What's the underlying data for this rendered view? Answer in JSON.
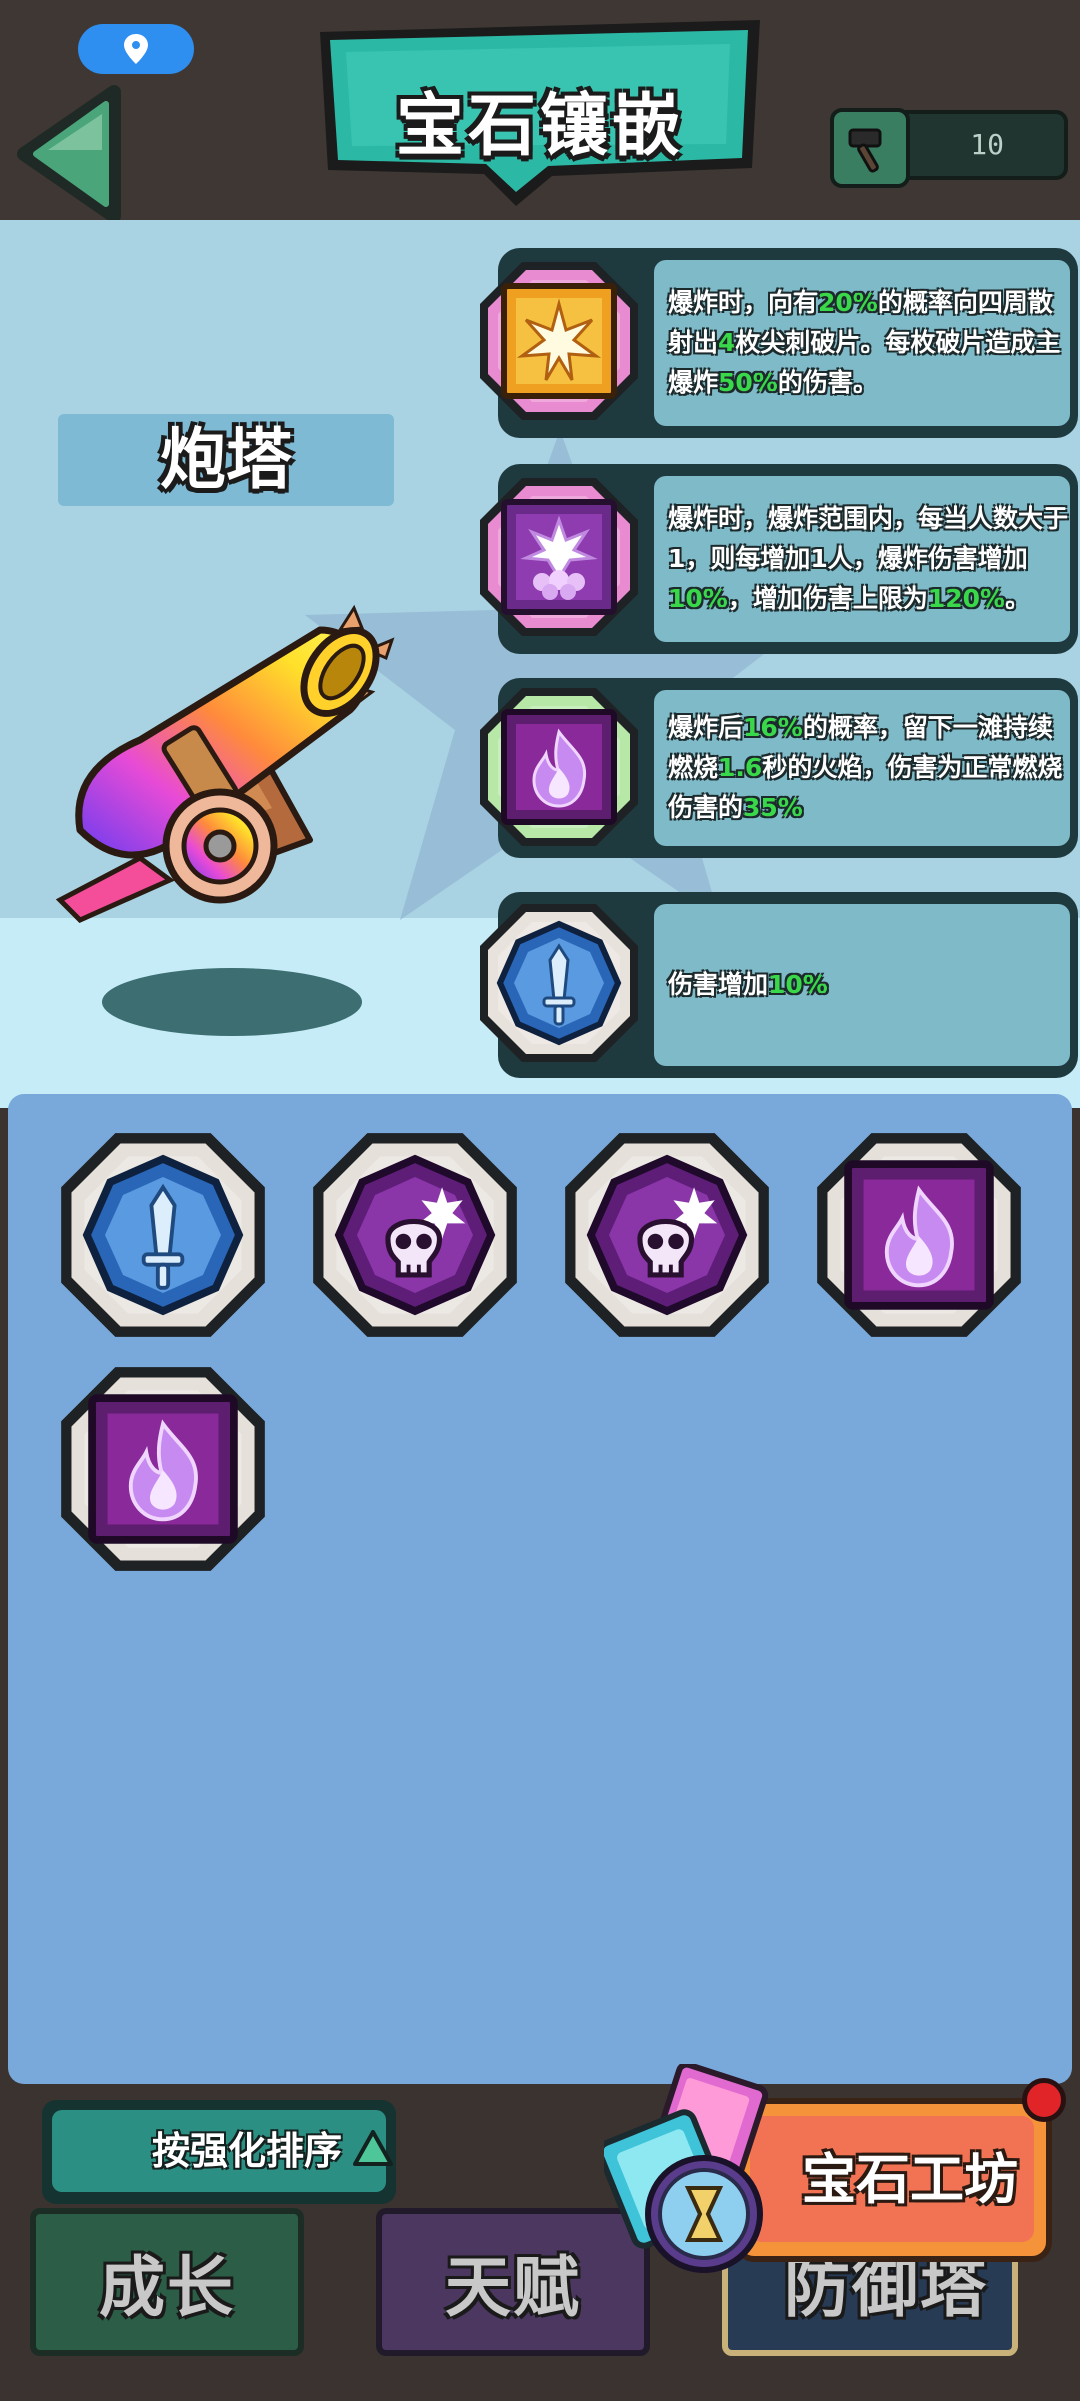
{
  "header": {
    "title": "宝石镶嵌",
    "hammer_count": "10"
  },
  "tower": {
    "name": "炮塔"
  },
  "socketed_gems": [
    {
      "icon": "golden-burst-gem-icon",
      "frame_color": "#e98bd0",
      "segments": [
        {
          "text": "爆炸时，向有",
          "hl": false
        },
        {
          "text": "20%",
          "hl": true
        },
        {
          "text": "的概率向四周散射出",
          "hl": false
        },
        {
          "text": "4",
          "hl": true
        },
        {
          "text": "枚尖刺破片。每枚破片造成主爆炸",
          "hl": false
        },
        {
          "text": "50%",
          "hl": true
        },
        {
          "text": "的伤害。",
          "hl": false
        }
      ]
    },
    {
      "icon": "crowd-burst-gem-icon",
      "frame_color": "#e98bd0",
      "segments": [
        {
          "text": "爆炸时，爆炸范围内，每当人数大于1，则每增加1人，爆炸伤害增加",
          "hl": false
        },
        {
          "text": "10%",
          "hl": true
        },
        {
          "text": "，增加伤害上限为",
          "hl": false
        },
        {
          "text": "120%",
          "hl": true
        },
        {
          "text": "。",
          "hl": false
        }
      ]
    },
    {
      "icon": "flame-gem-icon",
      "frame_color": "#b7e8a8",
      "segments": [
        {
          "text": "爆炸后",
          "hl": false
        },
        {
          "text": "16%",
          "hl": true
        },
        {
          "text": "的概率，留下一滩持续燃烧",
          "hl": false
        },
        {
          "text": "1.6",
          "hl": true
        },
        {
          "text": "秒的火焰，伤害为正常燃烧伤害的",
          "hl": false
        },
        {
          "text": "35%",
          "hl": true
        }
      ]
    },
    {
      "icon": "sword-gem-icon",
      "frame_color": "#e8e2dc",
      "segments": [
        {
          "text": "伤害增加",
          "hl": false
        },
        {
          "text": "10%",
          "hl": true
        }
      ]
    }
  ],
  "inventory": [
    {
      "icon": "sword-gem-icon"
    },
    {
      "icon": "skull-gem-icon"
    },
    {
      "icon": "skull-gem-icon"
    },
    {
      "icon": "flame-gem-icon"
    },
    {
      "icon": "flame-gem-icon"
    }
  ],
  "sort_button": {
    "label": "按强化排序"
  },
  "workshop_button": {
    "label": "宝石工坊"
  },
  "tabs": [
    {
      "label": "成长"
    },
    {
      "label": "天赋"
    },
    {
      "label": "防御塔"
    }
  ],
  "colors": {
    "highlight": "#39d84a",
    "title_banner": "#2bb8a5",
    "panel_blue": "#79a9da"
  }
}
